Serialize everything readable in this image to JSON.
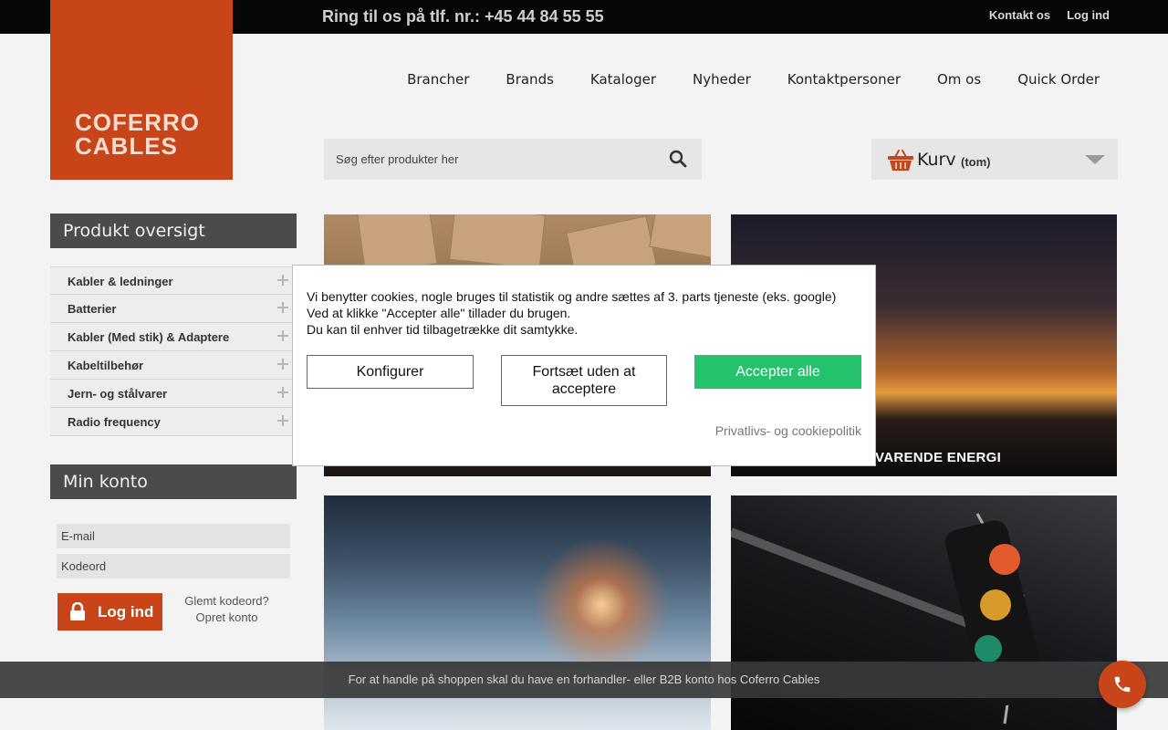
{
  "topbar": {
    "phone": "Ring til os på tlf. nr.: +45 44 84 55 55",
    "links": [
      "Kontakt os",
      "Log ind"
    ]
  },
  "logo": {
    "line1": "COFERRO",
    "line2": "CABLES"
  },
  "nav": [
    "Brancher",
    "Brands",
    "Kataloger",
    "Nyheder",
    "Kontaktpersoner",
    "Om os",
    "Quick Order"
  ],
  "search": {
    "placeholder": "Søg efter produkter her",
    "icon": "search-icon"
  },
  "cart": {
    "title": "Kurv",
    "state": "(tom)",
    "icon": "basket-icon"
  },
  "sidebar": {
    "products_title": "Produkt oversigt",
    "categories": [
      "Kabler & ledninger",
      "Batterier",
      "Kabler (Med stik) & Adaptere",
      "Kabeltilbehør",
      "Jern- og stålvarer",
      "Radio frequency"
    ],
    "account_title": "Min konto",
    "email_placeholder": "E-mail",
    "password_placeholder": "Kodeord",
    "login_label": "Log ind",
    "forgot_label": "Glemt kodeord?",
    "create_label": "Opret konto"
  },
  "tiles": {
    "energy_caption": "VARENDE ENERGI"
  },
  "cookie": {
    "line1": "Vi benytter cookies, nogle bruges til statistik og andre sættes af 3. parts tjeneste (eks. google)",
    "line2": "Ved at klikke \"Accepter alle\" tillader du brugen.",
    "line3": "Du kan til enhver tid tilbagetrække dit samtykke.",
    "configure_label": "Konfigurer",
    "continue_label": "Fortsæt uden at acceptere",
    "accept_label": "Accepter alle",
    "privacy_label": "Privatlivs- og cookiepolitik",
    "accept_color": "#25c26d"
  },
  "notice": {
    "text": "For at handle på shoppen skal du have en forhandler- eller B2B konto hos Coferro Cables"
  },
  "colors": {
    "brand": "#c8451a",
    "topbar": "#070707",
    "sidebar_head": "#4b4b4b"
  }
}
